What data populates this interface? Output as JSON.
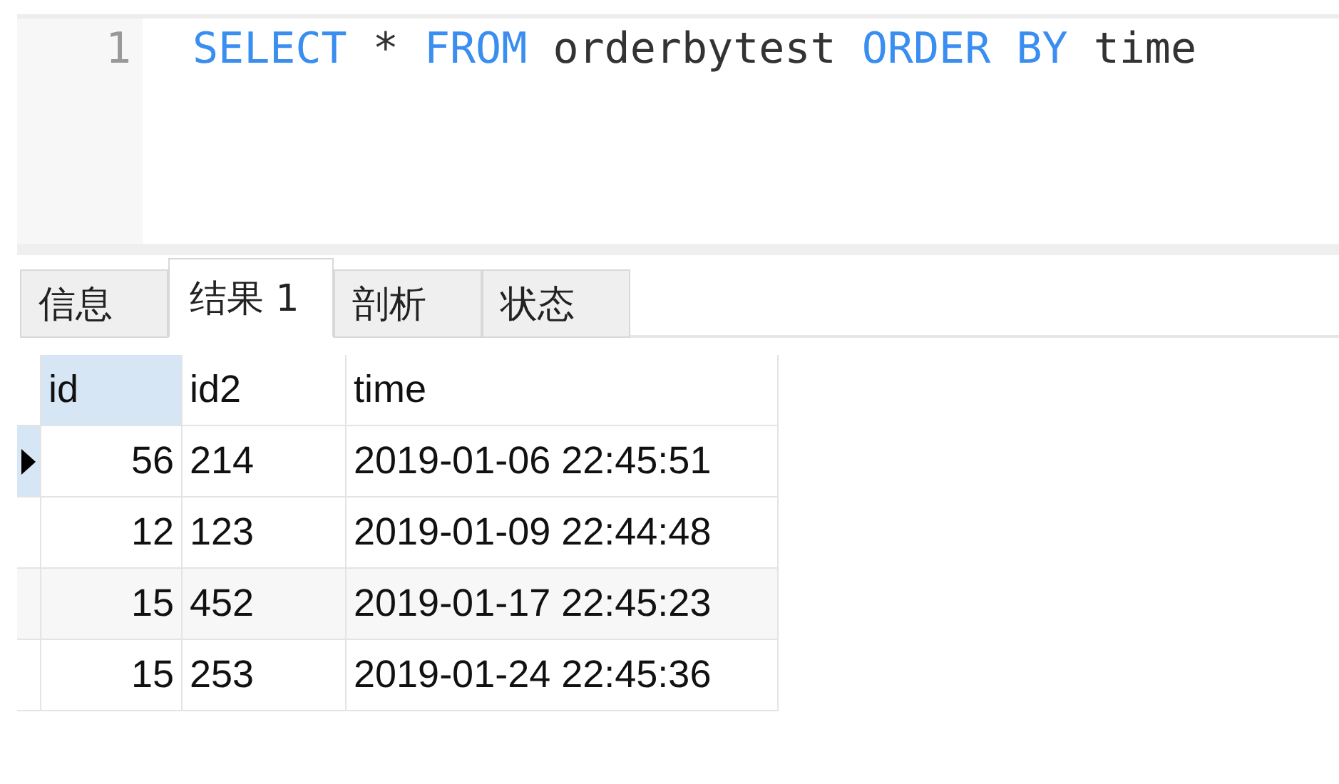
{
  "editor": {
    "lines": [
      {
        "number": "1",
        "tokens": [
          {
            "kind": "keyword",
            "text": "SELECT"
          },
          {
            "kind": "plain",
            "text": "*"
          },
          {
            "kind": "keyword",
            "text": "FROM"
          },
          {
            "kind": "plain",
            "text": "orderbytest"
          },
          {
            "kind": "keyword",
            "text": "ORDER"
          },
          {
            "kind": "keyword",
            "text": "BY"
          },
          {
            "kind": "plain",
            "text": "time"
          }
        ]
      }
    ]
  },
  "tabs": [
    {
      "label": "信息",
      "selected": false
    },
    {
      "label": "结果 1",
      "selected": true
    },
    {
      "label": "剖析",
      "selected": false
    },
    {
      "label": "状态",
      "selected": false
    }
  ],
  "table": {
    "columns": [
      {
        "label": "id",
        "selected": true,
        "kind": "number"
      },
      {
        "label": "id2",
        "selected": false,
        "kind": "text"
      },
      {
        "label": "time",
        "selected": false,
        "kind": "text"
      }
    ],
    "rows": [
      {
        "selected": true,
        "cells": [
          "56",
          "214",
          "2019-01-06 22:45:51"
        ]
      },
      {
        "selected": false,
        "cells": [
          "12",
          "123",
          "2019-01-09 22:44:48"
        ]
      },
      {
        "selected": false,
        "cells": [
          "15",
          "452",
          "2019-01-17 22:45:23"
        ]
      },
      {
        "selected": false,
        "cells": [
          "15",
          "253",
          "2019-01-24 22:45:36"
        ]
      }
    ]
  }
}
